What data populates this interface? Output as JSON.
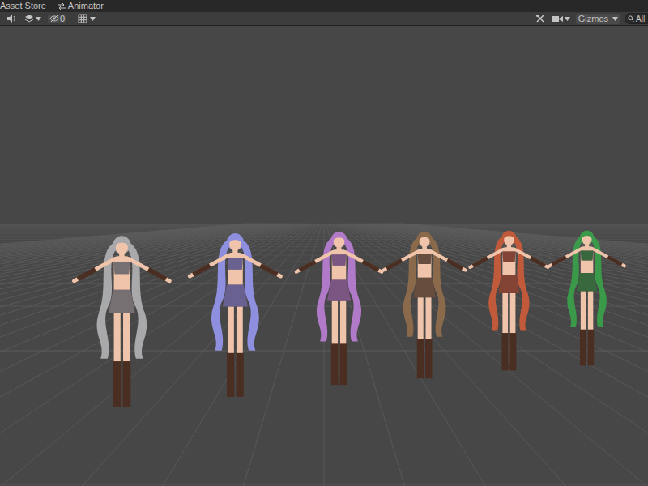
{
  "tabs": [
    {
      "label": "Asset Store",
      "selected": false
    },
    {
      "label": "Animator",
      "selected": false
    }
  ],
  "toolbar": {
    "hidden_count": "0",
    "gizmos": "Gizmos",
    "search": {
      "placeholder": "All"
    }
  },
  "scene": {
    "characters": [
      {
        "color": "#a9a9ab"
      },
      {
        "color": "#8f8fe0"
      },
      {
        "color": "#b07ac8"
      },
      {
        "color": "#8a6a4a"
      },
      {
        "color": "#c05a3a"
      },
      {
        "color": "#3a9a4a"
      }
    ]
  }
}
